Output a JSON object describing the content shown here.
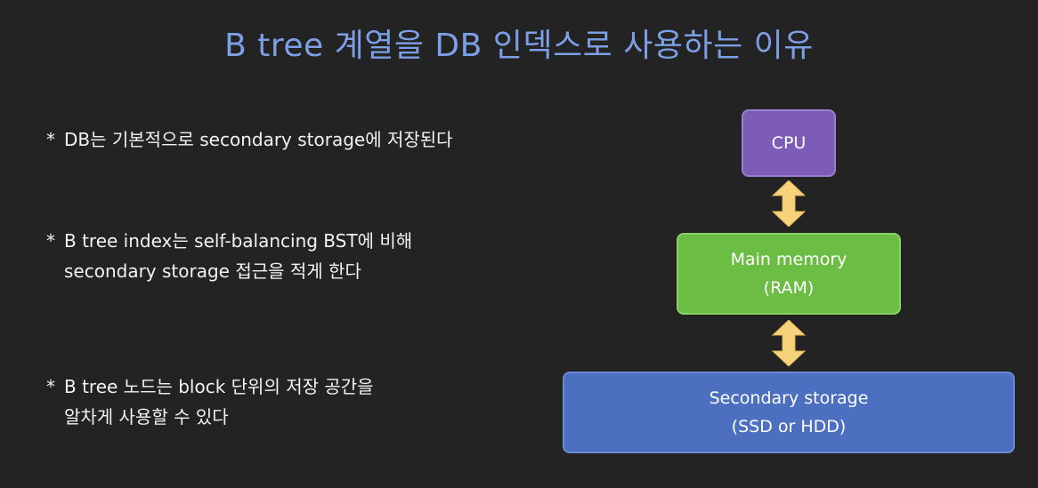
{
  "title": "B tree 계열을 DB 인덱스로 사용하는 이유",
  "bullets": [
    {
      "marker": "*",
      "line1": "DB는 기본적으로 secondary storage에 저장된다"
    },
    {
      "marker": "*",
      "line1": "B tree index는 self-balancing BST에 비해",
      "line2": "secondary storage 접근을 적게 한다"
    },
    {
      "marker": "*",
      "line1": "B tree 노드는 block 단위의 저장 공간을",
      "line2": "알차게 사용할 수 있다"
    }
  ],
  "diagram": {
    "cpu": {
      "label": "CPU",
      "color": "#7d5cb8"
    },
    "ram": {
      "label_line1": "Main memory",
      "label_line2": "(RAM)",
      "color": "#6cbd44"
    },
    "storage": {
      "label_line1": "Secondary storage",
      "label_line2": "(SSD or HDD)",
      "color": "#4d6fbf"
    },
    "arrow_color": "#f6d27a",
    "arrow_icon": "double-headed-vertical-arrow"
  }
}
